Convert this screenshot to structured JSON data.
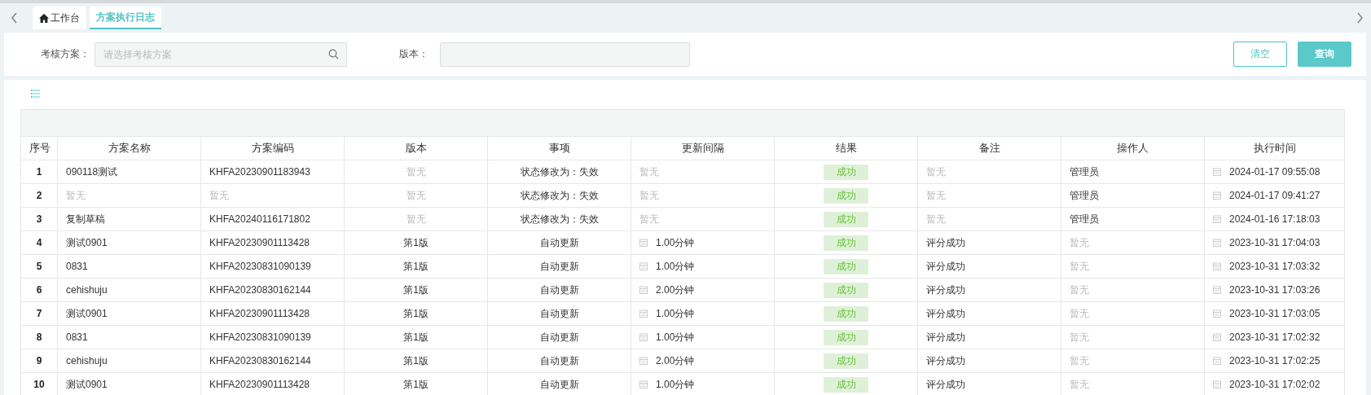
{
  "tabs": [
    {
      "label": "工作台",
      "kind": "home",
      "selected": false
    },
    {
      "label": "方案执行日志",
      "kind": "plain",
      "selected": true
    }
  ],
  "filters": {
    "scheme_label": "考核方案：",
    "scheme_placeholder": "请选择考核方案",
    "version_label": "版本：",
    "buttons": [
      {
        "label": "清空",
        "kind": "outline"
      },
      {
        "label": "查询",
        "kind": "primary"
      }
    ]
  },
  "table": {
    "columns": [
      "序号",
      "方案名称",
      "方案编码",
      "版本",
      "事项",
      "更新间隔",
      "结果",
      "备注",
      "操作人",
      "执行时间"
    ],
    "rows": [
      {
        "cells": [
          {
            "kind": "text",
            "text": "1",
            "muted": false
          },
          {
            "kind": "text",
            "text": "090118测试",
            "muted": false
          },
          {
            "kind": "text",
            "text": "KHFA20230901183943",
            "muted": false
          },
          {
            "kind": "text",
            "text": "暂无",
            "muted": true
          },
          {
            "kind": "text",
            "text": "状态修改为：失效",
            "muted": false
          },
          {
            "kind": "text",
            "text": "暂无",
            "muted": true
          },
          {
            "kind": "badge",
            "text": "成功",
            "muted": false
          },
          {
            "kind": "text",
            "text": "暂无",
            "muted": true
          },
          {
            "kind": "text",
            "text": "管理员",
            "muted": false
          },
          {
            "kind": "icon_text",
            "text": "2024-01-17 09:55:08",
            "muted": false
          }
        ]
      },
      {
        "cells": [
          {
            "kind": "text",
            "text": "2",
            "muted": false
          },
          {
            "kind": "text",
            "text": "暂无",
            "muted": true
          },
          {
            "kind": "text",
            "text": "暂无",
            "muted": true
          },
          {
            "kind": "text",
            "text": "暂无",
            "muted": true
          },
          {
            "kind": "text",
            "text": "状态修改为：失效",
            "muted": false
          },
          {
            "kind": "text",
            "text": "暂无",
            "muted": true
          },
          {
            "kind": "badge",
            "text": "成功",
            "muted": false
          },
          {
            "kind": "text",
            "text": "暂无",
            "muted": true
          },
          {
            "kind": "text",
            "text": "管理员",
            "muted": false
          },
          {
            "kind": "icon_text",
            "text": "2024-01-17 09:41:27",
            "muted": false
          }
        ]
      },
      {
        "cells": [
          {
            "kind": "text",
            "text": "3",
            "muted": false
          },
          {
            "kind": "text",
            "text": "复制草稿",
            "muted": false
          },
          {
            "kind": "text",
            "text": "KHFA20240116171802",
            "muted": false
          },
          {
            "kind": "text",
            "text": "暂无",
            "muted": true
          },
          {
            "kind": "text",
            "text": "状态修改为：失效",
            "muted": false
          },
          {
            "kind": "text",
            "text": "暂无",
            "muted": true
          },
          {
            "kind": "badge",
            "text": "成功",
            "muted": false
          },
          {
            "kind": "text",
            "text": "暂无",
            "muted": true
          },
          {
            "kind": "text",
            "text": "管理员",
            "muted": false
          },
          {
            "kind": "icon_text",
            "text": "2024-01-16 17:18:03",
            "muted": false
          }
        ]
      },
      {
        "cells": [
          {
            "kind": "text",
            "text": "4",
            "muted": false
          },
          {
            "kind": "text",
            "text": "测试0901",
            "muted": false
          },
          {
            "kind": "text",
            "text": "KHFA20230901113428",
            "muted": false
          },
          {
            "kind": "text",
            "text": "第1版",
            "muted": false
          },
          {
            "kind": "text",
            "text": "自动更新",
            "muted": false
          },
          {
            "kind": "icon_text",
            "text": "1.00分钟",
            "muted": false
          },
          {
            "kind": "badge",
            "text": "成功",
            "muted": false
          },
          {
            "kind": "text",
            "text": "评分成功",
            "muted": false
          },
          {
            "kind": "text",
            "text": "暂无",
            "muted": true
          },
          {
            "kind": "icon_text",
            "text": "2023-10-31 17:04:03",
            "muted": false
          }
        ]
      },
      {
        "cells": [
          {
            "kind": "text",
            "text": "5",
            "muted": false
          },
          {
            "kind": "text",
            "text": "0831",
            "muted": false
          },
          {
            "kind": "text",
            "text": "KHFA20230831090139",
            "muted": false
          },
          {
            "kind": "text",
            "text": "第1版",
            "muted": false
          },
          {
            "kind": "text",
            "text": "自动更新",
            "muted": false
          },
          {
            "kind": "icon_text",
            "text": "1.00分钟",
            "muted": false
          },
          {
            "kind": "badge",
            "text": "成功",
            "muted": false
          },
          {
            "kind": "text",
            "text": "评分成功",
            "muted": false
          },
          {
            "kind": "text",
            "text": "暂无",
            "muted": true
          },
          {
            "kind": "icon_text",
            "text": "2023-10-31 17:03:32",
            "muted": false
          }
        ]
      },
      {
        "cells": [
          {
            "kind": "text",
            "text": "6",
            "muted": false
          },
          {
            "kind": "text",
            "text": "cehishuju",
            "muted": false
          },
          {
            "kind": "text",
            "text": "KHFA20230830162144",
            "muted": false
          },
          {
            "kind": "text",
            "text": "第1版",
            "muted": false
          },
          {
            "kind": "text",
            "text": "自动更新",
            "muted": false
          },
          {
            "kind": "icon_text",
            "text": "2.00分钟",
            "muted": false
          },
          {
            "kind": "badge",
            "text": "成功",
            "muted": false
          },
          {
            "kind": "text",
            "text": "评分成功",
            "muted": false
          },
          {
            "kind": "text",
            "text": "暂无",
            "muted": true
          },
          {
            "kind": "icon_text",
            "text": "2023-10-31 17:03:26",
            "muted": false
          }
        ]
      },
      {
        "cells": [
          {
            "kind": "text",
            "text": "7",
            "muted": false
          },
          {
            "kind": "text",
            "text": "测试0901",
            "muted": false
          },
          {
            "kind": "text",
            "text": "KHFA20230901113428",
            "muted": false
          },
          {
            "kind": "text",
            "text": "第1版",
            "muted": false
          },
          {
            "kind": "text",
            "text": "自动更新",
            "muted": false
          },
          {
            "kind": "icon_text",
            "text": "1.00分钟",
            "muted": false
          },
          {
            "kind": "badge",
            "text": "成功",
            "muted": false
          },
          {
            "kind": "text",
            "text": "评分成功",
            "muted": false
          },
          {
            "kind": "text",
            "text": "暂无",
            "muted": true
          },
          {
            "kind": "icon_text",
            "text": "2023-10-31 17:03:05",
            "muted": false
          }
        ]
      },
      {
        "cells": [
          {
            "kind": "text",
            "text": "8",
            "muted": false
          },
          {
            "kind": "text",
            "text": "0831",
            "muted": false
          },
          {
            "kind": "text",
            "text": "KHFA20230831090139",
            "muted": false
          },
          {
            "kind": "text",
            "text": "第1版",
            "muted": false
          },
          {
            "kind": "text",
            "text": "自动更新",
            "muted": false
          },
          {
            "kind": "icon_text",
            "text": "1.00分钟",
            "muted": false
          },
          {
            "kind": "badge",
            "text": "成功",
            "muted": false
          },
          {
            "kind": "text",
            "text": "评分成功",
            "muted": false
          },
          {
            "kind": "text",
            "text": "暂无",
            "muted": true
          },
          {
            "kind": "icon_text",
            "text": "2023-10-31 17:02:32",
            "muted": false
          }
        ]
      },
      {
        "cells": [
          {
            "kind": "text",
            "text": "9",
            "muted": false
          },
          {
            "kind": "text",
            "text": "cehishuju",
            "muted": false
          },
          {
            "kind": "text",
            "text": "KHFA20230830162144",
            "muted": false
          },
          {
            "kind": "text",
            "text": "第1版",
            "muted": false
          },
          {
            "kind": "text",
            "text": "自动更新",
            "muted": false
          },
          {
            "kind": "icon_text",
            "text": "2.00分钟",
            "muted": false
          },
          {
            "kind": "badge",
            "text": "成功",
            "muted": false
          },
          {
            "kind": "text",
            "text": "评分成功",
            "muted": false
          },
          {
            "kind": "text",
            "text": "暂无",
            "muted": true
          },
          {
            "kind": "icon_text",
            "text": "2023-10-31 17:02:25",
            "muted": false
          }
        ]
      },
      {
        "cells": [
          {
            "kind": "text",
            "text": "10",
            "muted": false
          },
          {
            "kind": "text",
            "text": "测试0901",
            "muted": false
          },
          {
            "kind": "text",
            "text": "KHFA20230901113428",
            "muted": false
          },
          {
            "kind": "text",
            "text": "第1版",
            "muted": false
          },
          {
            "kind": "text",
            "text": "自动更新",
            "muted": false
          },
          {
            "kind": "icon_text",
            "text": "1.00分钟",
            "muted": false
          },
          {
            "kind": "badge",
            "text": "成功",
            "muted": false
          },
          {
            "kind": "text",
            "text": "评分成功",
            "muted": false
          },
          {
            "kind": "text",
            "text": "暂无",
            "muted": true
          },
          {
            "kind": "icon_text",
            "text": "2023-10-31 17:02:02",
            "muted": false
          }
        ]
      }
    ]
  }
}
